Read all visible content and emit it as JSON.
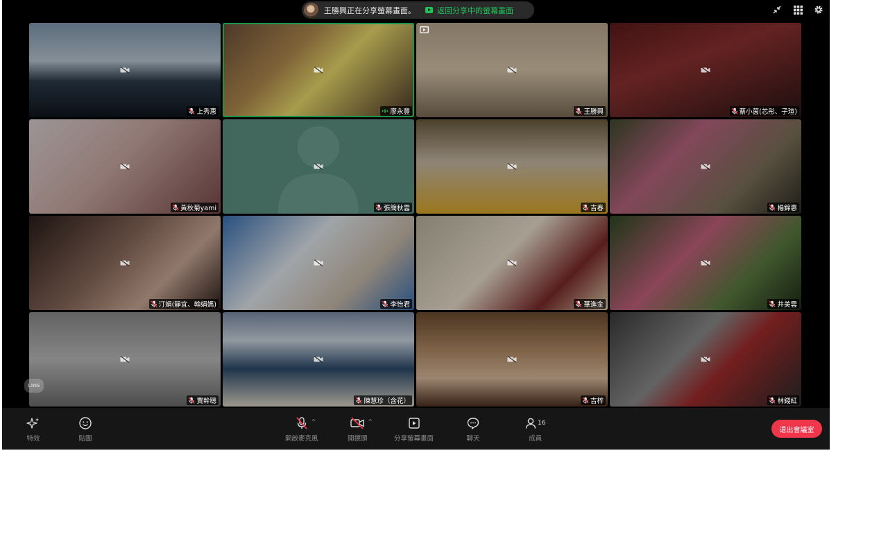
{
  "banner": {
    "sharing_text": "王勝興正在分享螢幕畫面。",
    "return_text": "返回分享中的螢幕畫面"
  },
  "top_icons": [
    "minimize-icon",
    "grid-view-icon",
    "settings-icon"
  ],
  "participants": [
    {
      "name": "上秀惠",
      "bg": "linear-gradient(180deg,#7f96ad 0%,#b8c6d2 40%,#2c3a4a 62%,#0e151d 100%)"
    },
    {
      "name": "廖永豐",
      "bg": "linear-gradient(135deg,#6b4e3a 0%,#b08a4e 35%,#e8d86a 55%,#4a3528 100%)",
      "speaking": true
    },
    {
      "name": "王勝興",
      "bg": "linear-gradient(180deg,#b7a58d 0%,#d4c2a7 50%,#7a6a56 100%)",
      "pinned": true
    },
    {
      "name": "蔡小茵(芯彤、子瑄)",
      "bg": "linear-gradient(160deg,#5b1a1a 0%,#8b3030 40%,#2a1414 100%)"
    },
    {
      "name": "黃秋菊yami",
      "bg": "linear-gradient(135deg,#d9cfd1 0%,#c9a8a2 45%,#7a4a4a 100%)"
    },
    {
      "name": "張簡秋雲",
      "bg": "#5c8f81",
      "avatar": true
    },
    {
      "name": "吉春",
      "bg": "linear-gradient(180deg,#6a5a3c 0%,#c6b8a5 45%,#d7a52a 100%)"
    },
    {
      "name": "楊錦惠",
      "bg": "linear-gradient(135deg,#3e4a2c 0%,#b5637e 35%,#7a6f58 70%,#2a2a22 100%)"
    },
    {
      "name": "汀娟(靜宜、翰娟媽)",
      "bg": "linear-gradient(135deg,#2a1c18 0%,#8a6a5c 45%,#c9a796 70%,#2a1c18 100%)"
    },
    {
      "name": "李怡君",
      "bg": "linear-gradient(135deg,#3a6fb0 0%,#dfe4ea 40%,#c7b9a8 70%,#3a6fb0 100%)"
    },
    {
      "name": "華進金",
      "bg": "linear-gradient(135deg,#b6b09c 0%,#e7dccb 45%,#7a2a2a 75%,#d8c8a8 100%)"
    },
    {
      "name": "井美雲",
      "bg": "linear-gradient(135deg,#2c4a22 0%,#c0607a 40%,#5a7a40 70%,#1c2a16 100%)"
    },
    {
      "name": "賈幹聰",
      "bg": "linear-gradient(180deg,#8a8a8a 0%,#b9b9b9 50%,#6a6a6a 100%)"
    },
    {
      "name": "陳慧珍（含花）",
      "bg": "linear-gradient(180deg,#7a8ba4 0%,#c9d3de 30%,#2c4a6a 60%,#d8d2c2 100%)"
    },
    {
      "name": "吉梓",
      "bg": "linear-gradient(180deg,#6a4a30 0%,#b08a64 40%,#d8b89c 70%,#4a3020 100%)"
    },
    {
      "name": "林錢紅",
      "bg": "linear-gradient(135deg,#3a3a3a 0%,#8a8a8a 40%,#a02a2a 60%,#2a2a2a 100%)"
    }
  ],
  "line_logo_text": "LINE",
  "toolbar": {
    "effects_label": "特效",
    "stickers_label": "貼圖",
    "unmute_label": "開啟麥克風",
    "start_video_label": "開鏡頭",
    "share_screen_label": "分享螢幕畫面",
    "chat_label": "聊天",
    "members_label": "成員",
    "members_count": "16",
    "leave_label": "退出會議室"
  },
  "colors": {
    "accent_green": "#1fc35a",
    "leave_red": "#f0364b",
    "speaking_border": "#24d160"
  }
}
